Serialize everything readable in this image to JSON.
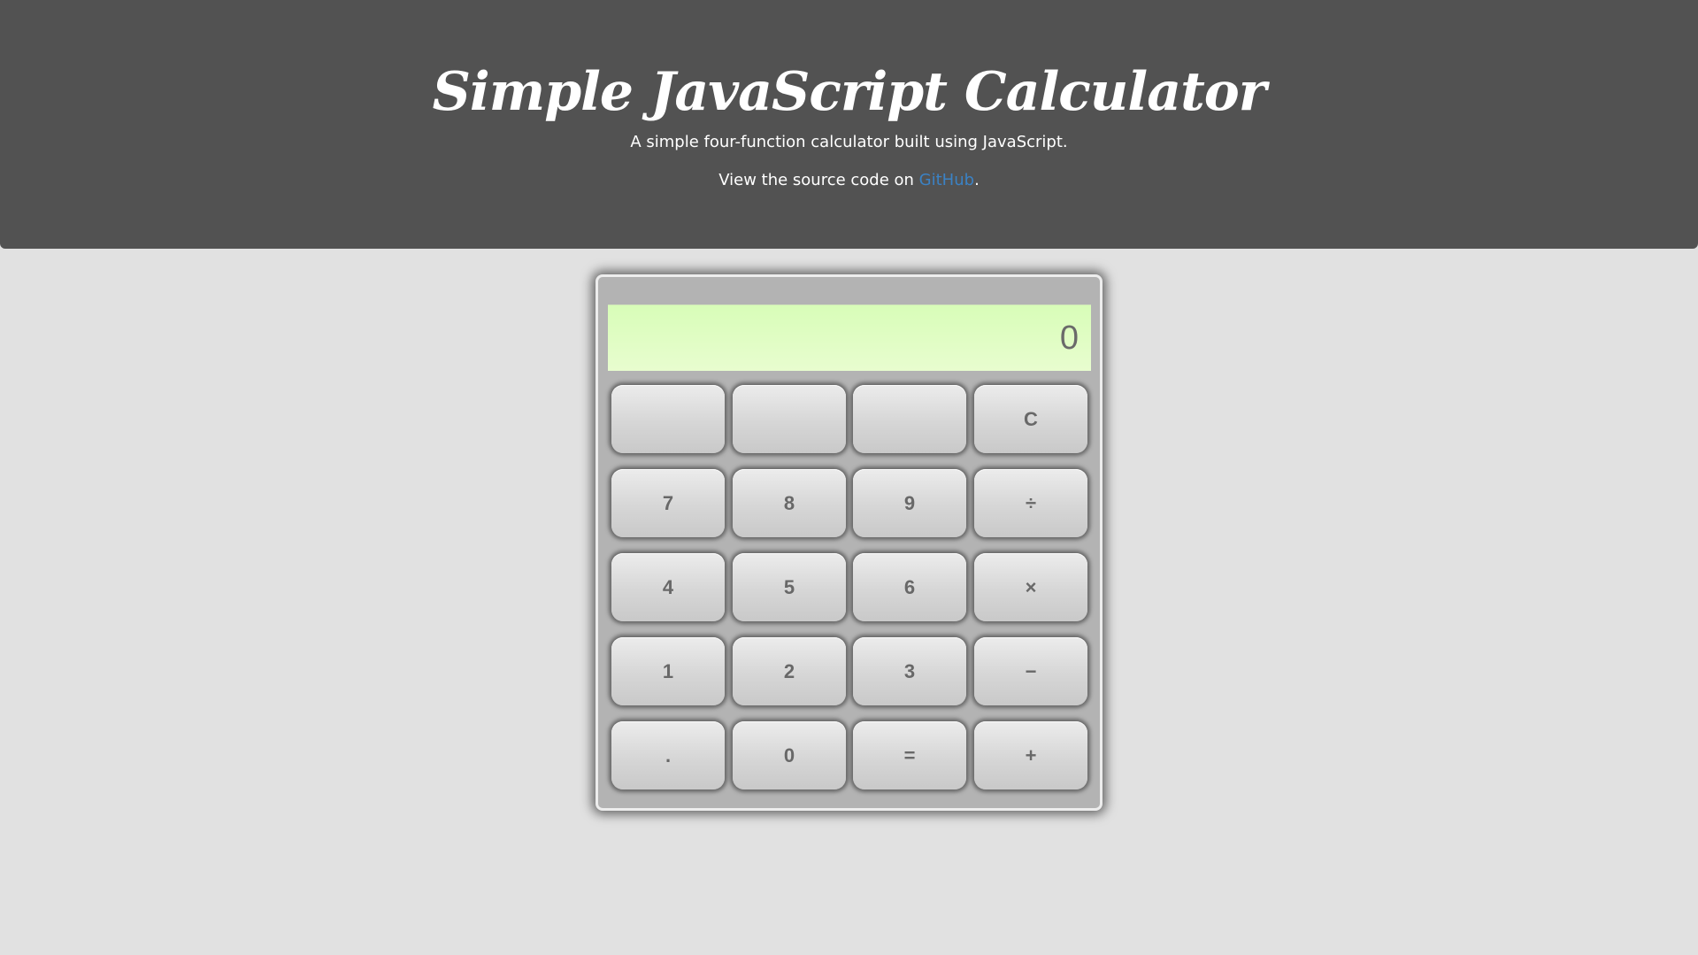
{
  "header": {
    "title": "Simple JavaScript Calculator",
    "subtitle": "A simple four-function calculator built using JavaScript.",
    "source_prefix": "View the source code on ",
    "source_link": "GitHub",
    "source_suffix": "."
  },
  "calculator": {
    "display_value": "0",
    "keys": {
      "blank1": "",
      "blank2": "",
      "blank3": "",
      "clear": "C",
      "seven": "7",
      "eight": "8",
      "nine": "9",
      "divide": "÷",
      "four": "4",
      "five": "5",
      "six": "6",
      "multiply": "×",
      "one": "1",
      "two": "2",
      "three": "3",
      "subtract": "−",
      "decimal": ".",
      "zero": "0",
      "equals": "=",
      "add": "+"
    }
  },
  "colors": {
    "header_bg": "#525252",
    "page_bg": "#e1e1e1",
    "display_bg": "#dcfdbd",
    "link": "#3b82c4",
    "key_text": "#686868"
  }
}
